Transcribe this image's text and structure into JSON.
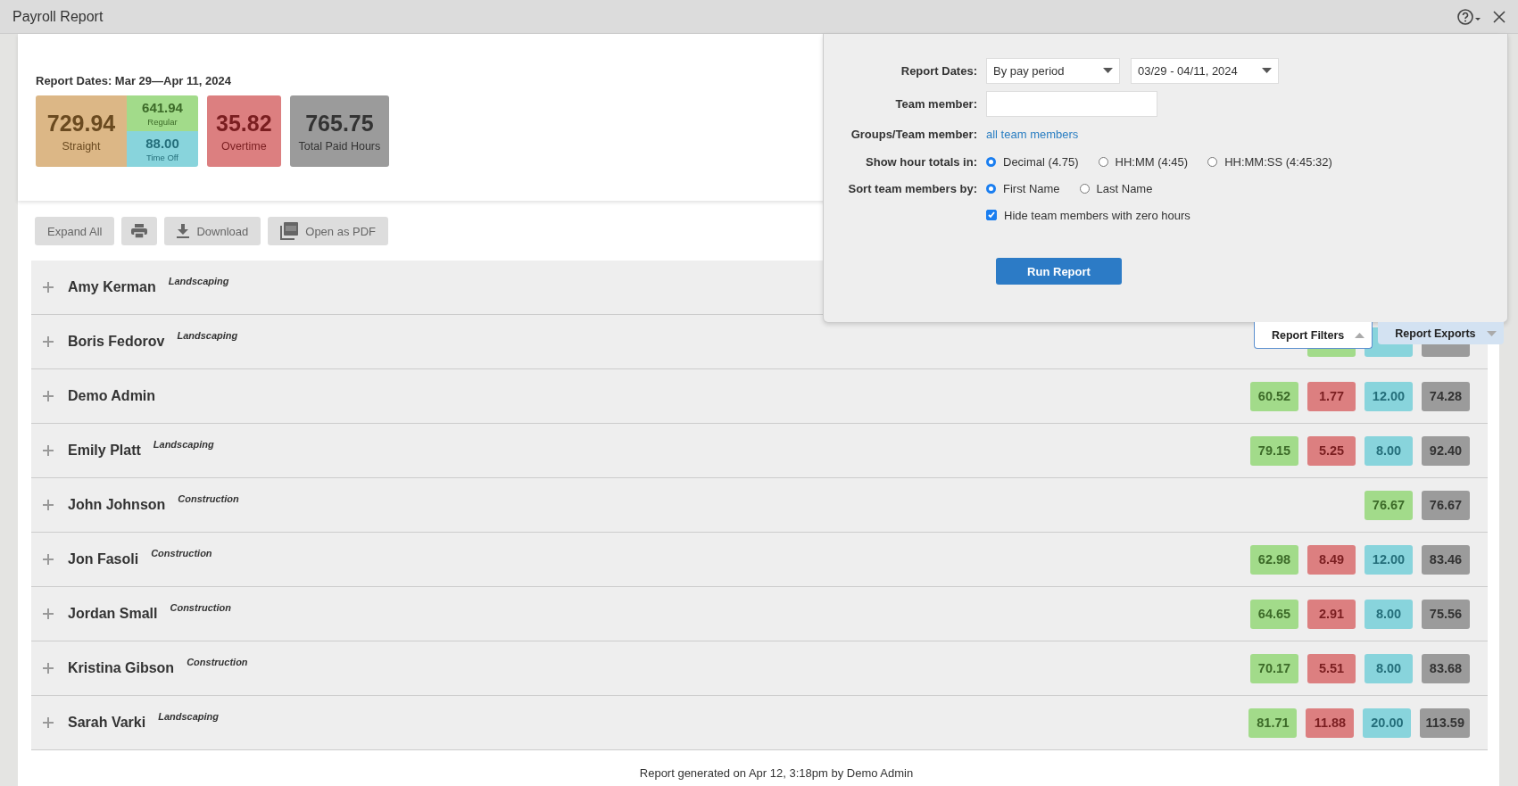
{
  "window": {
    "title": "Payroll Report"
  },
  "summary": {
    "report_dates": "Report Dates: Mar 29—Apr 11, 2024",
    "tiles": [
      {
        "kind": "straight",
        "value": "729.94",
        "label": "Straight",
        "parts": [
          {
            "kind": "regular",
            "value": "641.94",
            "label": "Regular"
          },
          {
            "kind": "timeoff",
            "value": "88.00",
            "label": "Time Off"
          }
        ]
      },
      {
        "kind": "overtime",
        "value": "35.82",
        "label": "Overtime"
      },
      {
        "kind": "total",
        "value": "765.75",
        "label": "Total Paid Hours"
      }
    ]
  },
  "toolbar": [
    {
      "kind": "text",
      "label": "Expand All"
    },
    {
      "kind": "print"
    },
    {
      "kind": "download",
      "label": "Download"
    },
    {
      "kind": "pdf",
      "label": "Open as PDF"
    }
  ],
  "rows": [
    {
      "name": "Amy Kerman",
      "group": "Landscaping",
      "expanded": false,
      "hours": []
    },
    {
      "name": "Boris Fedorov",
      "group": "Landscaping",
      "expanded": false,
      "hours": [
        {
          "kind": "regular"
        },
        {
          "kind": "timeoff"
        },
        {
          "kind": "total"
        }
      ]
    },
    {
      "name": "Demo Admin",
      "expanded": false,
      "hours": [
        {
          "kind": "regular",
          "value": "60.52"
        },
        {
          "kind": "overtime",
          "value": "1.77"
        },
        {
          "kind": "timeoff",
          "value": "12.00"
        },
        {
          "kind": "total",
          "value": "74.28"
        }
      ]
    },
    {
      "name": "Emily Platt",
      "group": "Landscaping",
      "expanded": false,
      "hours": [
        {
          "kind": "regular",
          "value": "79.15"
        },
        {
          "kind": "overtime",
          "value": "5.25"
        },
        {
          "kind": "timeoff",
          "value": "8.00"
        },
        {
          "kind": "total",
          "value": "92.40"
        }
      ]
    },
    {
      "name": "John Johnson",
      "group": "Construction",
      "expanded": false,
      "hours": [
        {
          "kind": "regular",
          "value": "76.67"
        },
        {
          "kind": "total",
          "value": "76.67"
        }
      ]
    },
    {
      "name": "Jon Fasoli",
      "group": "Construction",
      "expanded": false,
      "hours": [
        {
          "kind": "regular",
          "value": "62.98"
        },
        {
          "kind": "overtime",
          "value": "8.49"
        },
        {
          "kind": "timeoff",
          "value": "12.00"
        },
        {
          "kind": "total",
          "value": "83.46"
        }
      ]
    },
    {
      "name": "Jordan Small",
      "group": "Construction",
      "expanded": false,
      "hours": [
        {
          "kind": "regular",
          "value": "64.65"
        },
        {
          "kind": "overtime",
          "value": "2.91"
        },
        {
          "kind": "timeoff",
          "value": "8.00"
        },
        {
          "kind": "total",
          "value": "75.56"
        }
      ]
    },
    {
      "name": "Kristina Gibson",
      "group": "Construction",
      "expanded": false,
      "hours": [
        {
          "kind": "regular",
          "value": "70.17"
        },
        {
          "kind": "overtime",
          "value": "5.51"
        },
        {
          "kind": "timeoff",
          "value": "8.00"
        },
        {
          "kind": "total",
          "value": "83.68"
        }
      ]
    },
    {
      "name": "Sarah Varki",
      "group": "Landscaping",
      "expanded": false,
      "hours": [
        {
          "kind": "regular",
          "value": "81.71"
        },
        {
          "kind": "overtime",
          "value": "11.88"
        },
        {
          "kind": "timeoff",
          "value": "20.00"
        },
        {
          "kind": "total",
          "value": "113.59"
        }
      ]
    }
  ],
  "footer": "Report generated on Apr 12, 3:18pm by Demo Admin",
  "filters": {
    "report_dates_label": "Report Dates:",
    "period": "By pay period",
    "range": "03/29 - 04/11, 2024",
    "team_member_label": "Team member:",
    "groups_label": "Groups/Team member:",
    "groups_link": "all team members",
    "hour_totals_label": "Show hour totals in:",
    "hour_totals": [
      {
        "label": "Decimal (4.75)",
        "selected": true
      },
      {
        "label": "HH:MM (4:45)",
        "selected": false
      },
      {
        "label": "HH:MM:SS (4:45:32)",
        "selected": false
      }
    ],
    "sort_label": "Sort team members by:",
    "sort": [
      {
        "label": "First Name",
        "selected": true
      },
      {
        "label": "Last Name",
        "selected": false
      }
    ],
    "hide_zero": {
      "label": "Hide team members with zero hours",
      "checked": true
    },
    "run_button": "Run Report"
  },
  "panel_tabs": [
    {
      "label": "Report Filters",
      "expanded": true
    },
    {
      "label": "Report Exports",
      "expanded": false
    }
  ]
}
